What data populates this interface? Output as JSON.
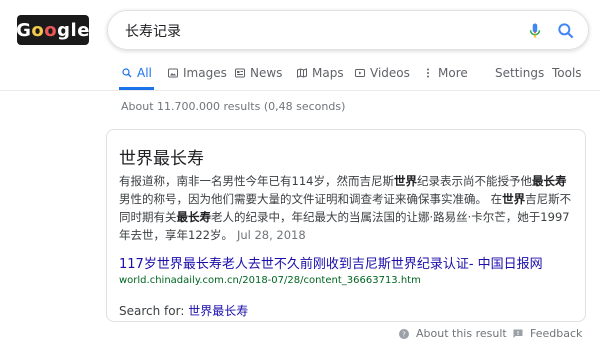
{
  "logo": {
    "text_g": "G",
    "text_o1": "o",
    "text_o2": "o",
    "text_rest": "gle"
  },
  "search": {
    "query": "长寿记录"
  },
  "tabs": [
    {
      "label": "All",
      "icon": "search-icon"
    },
    {
      "label": "Images",
      "icon": "image-icon"
    },
    {
      "label": "News",
      "icon": "news-icon"
    },
    {
      "label": "Maps",
      "icon": "map-icon"
    },
    {
      "label": "Videos",
      "icon": "video-icon"
    },
    {
      "label": "More",
      "icon": "more-vert-icon"
    }
  ],
  "tools": {
    "settings": "Settings",
    "tools": "Tools"
  },
  "results_stats": "About 11.700.000 results (0,48 seconds)",
  "featured": {
    "title": "世界最长寿",
    "snippet_parts": [
      {
        "text": "有报道称，南非一名男性今年已有114岁，然而吉尼斯",
        "bold": false
      },
      {
        "text": "世界",
        "bold": true
      },
      {
        "text": "纪录表示尚不能授予他",
        "bold": false
      },
      {
        "text": "最长寿",
        "bold": true
      },
      {
        "text": "男性的称号，因为他们需要大量的文件证明和调查考证来确保事实准确。 在",
        "bold": false
      },
      {
        "text": "世界",
        "bold": true
      },
      {
        "text": "吉尼斯不同时期有关",
        "bold": false
      },
      {
        "text": "最长寿",
        "bold": true
      },
      {
        "text": "老人的纪录中，年纪最大的当属法国的让娜·路易丝·卡尔芒，她于1997年去世，享年122岁。",
        "bold": false
      }
    ],
    "date": "Jul 28, 2018",
    "link_title": "117岁世界最长寿老人去世不久前刚收到吉尼斯世界纪录认证- 中国日报网",
    "url": "world.chinadaily.com.cn/2018-07/28/content_36663713.htm",
    "search_for_label": "Search for:",
    "search_for_query": "世界最长寿"
  },
  "footer": {
    "about": "About this result",
    "feedback": "Feedback"
  },
  "colors": {
    "accent": "#1a73e8",
    "link": "#1a0dab",
    "url": "#006621"
  }
}
